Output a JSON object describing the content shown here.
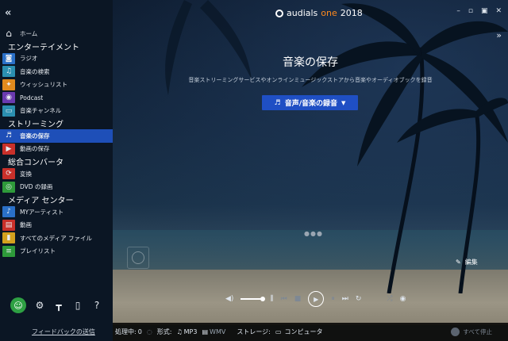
{
  "window": {
    "brand": "audials",
    "brand_one": "one",
    "brand_year": "2018"
  },
  "sidebar": {
    "items": [
      {
        "type": "item",
        "label": "ホーム",
        "icon": "home-icon"
      },
      {
        "type": "section",
        "label": "エンターテイメント"
      },
      {
        "type": "item",
        "label": "ラジオ",
        "icon": "radio-icon"
      },
      {
        "type": "item",
        "label": "音楽の検索",
        "icon": "music-search-icon"
      },
      {
        "type": "item",
        "label": "ウィッシュリスト",
        "icon": "wishlist-icon"
      },
      {
        "type": "item",
        "label": "Podcast",
        "icon": "podcast-icon"
      },
      {
        "type": "item",
        "label": "音楽チャンネル",
        "icon": "music-channel-icon"
      },
      {
        "type": "section",
        "label": "ストリーミング"
      },
      {
        "type": "item",
        "label": "音楽の保存",
        "icon": "music-record-icon",
        "active": true
      },
      {
        "type": "item",
        "label": "動画の保存",
        "icon": "video-record-icon"
      },
      {
        "type": "section",
        "label": "総合コンバータ"
      },
      {
        "type": "item",
        "label": "変換",
        "icon": "convert-icon"
      },
      {
        "type": "item",
        "label": "DVD の録画",
        "icon": "dvd-icon"
      },
      {
        "type": "section",
        "label": "メディア センター"
      },
      {
        "type": "item",
        "label": "MYアーティスト",
        "icon": "my-artist-icon"
      },
      {
        "type": "item",
        "label": "動画",
        "icon": "video-icon"
      },
      {
        "type": "item",
        "label": "すべてのメディア ファイル",
        "icon": "all-media-icon"
      },
      {
        "type": "item",
        "label": "プレイリスト",
        "icon": "playlist-icon"
      }
    ],
    "feedback": "フィードバックの送信",
    "help": "?"
  },
  "hero": {
    "title": "音楽の保存",
    "subtitle": "音楽ストリーミングサービスやオンラインミュージックストアから音楽やオーディオブックを録音",
    "record_button": "音声/音楽の録音",
    "edit": "編集"
  },
  "status": {
    "processing_label": "処理中:",
    "processing_value": "0",
    "format_label": "形式:",
    "format_mp3": "MP3",
    "format_wmv": "WMV",
    "storage_label": "ストレージ:",
    "storage_value": "コンピュータ",
    "stop_all": "すべて停止"
  },
  "colors": {
    "accent": "#1f4fc4",
    "active": "#1e4fb8",
    "brand_orange": "#ff8a1e"
  }
}
